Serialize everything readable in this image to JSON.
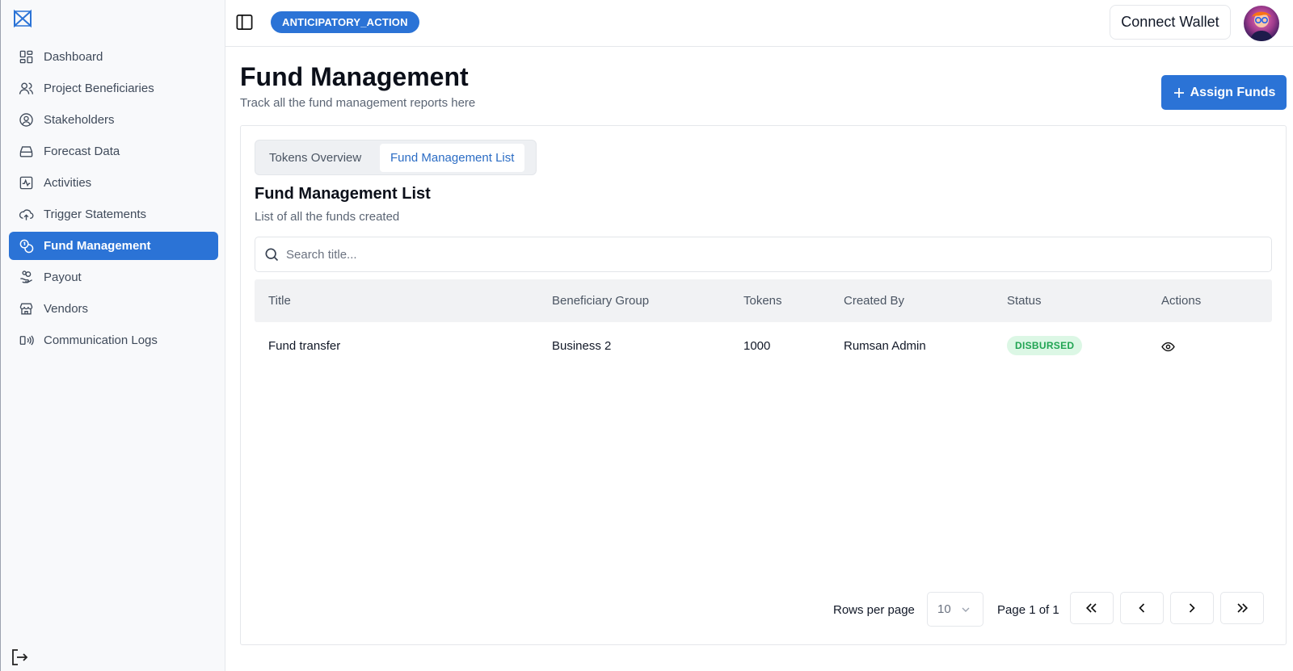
{
  "sidebar": {
    "logo_icon": "app-logo",
    "items": [
      {
        "label": "Dashboard",
        "icon": "dashboard-grid-icon",
        "active": false
      },
      {
        "label": "Project Beneficiaries",
        "icon": "users-icon",
        "active": false
      },
      {
        "label": "Stakeholders",
        "icon": "user-circle-icon",
        "active": false
      },
      {
        "label": "Forecast Data",
        "icon": "hard-drive-icon",
        "active": false
      },
      {
        "label": "Activities",
        "icon": "activity-icon",
        "active": false
      },
      {
        "label": "Trigger Statements",
        "icon": "cloud-upload-icon",
        "active": false
      },
      {
        "label": "Fund Management",
        "icon": "coins-icon",
        "active": true
      },
      {
        "label": "Payout",
        "icon": "hand-coins-icon",
        "active": false
      },
      {
        "label": "Vendors",
        "icon": "store-icon",
        "active": false
      },
      {
        "label": "Communication Logs",
        "icon": "broadcast-icon",
        "active": false
      }
    ],
    "logout_icon": "logout-icon"
  },
  "topbar": {
    "project_tag": "ANTICIPATORY_ACTION",
    "connect_wallet": "Connect Wallet"
  },
  "page": {
    "title": "Fund Management",
    "subtitle": "Track all the fund management reports here",
    "assign_button": "Assign Funds"
  },
  "tabs": [
    "Tokens Overview",
    "Fund Management List"
  ],
  "active_tab": "Fund Management List",
  "list": {
    "title": "Fund Management List",
    "subtitle": "List of all the funds created",
    "search_placeholder": "Search title..."
  },
  "table": {
    "columns": [
      "Title",
      "Beneficiary Group",
      "Tokens",
      "Created By",
      "Status",
      "Actions"
    ],
    "rows": [
      {
        "title": "Fund transfer",
        "group": "Business 2",
        "tokens": "1000",
        "created_by": "Rumsan Admin",
        "status": "DISBURSED",
        "action_icon": "eye-icon"
      }
    ]
  },
  "pagination": {
    "rows_label": "Rows per page",
    "rows_value": "10",
    "page_label": "Page 1 of 1"
  },
  "colors": {
    "accent": "#2b73d6",
    "status_success_bg": "#dcf7e5",
    "status_success_text": "#20a452"
  }
}
